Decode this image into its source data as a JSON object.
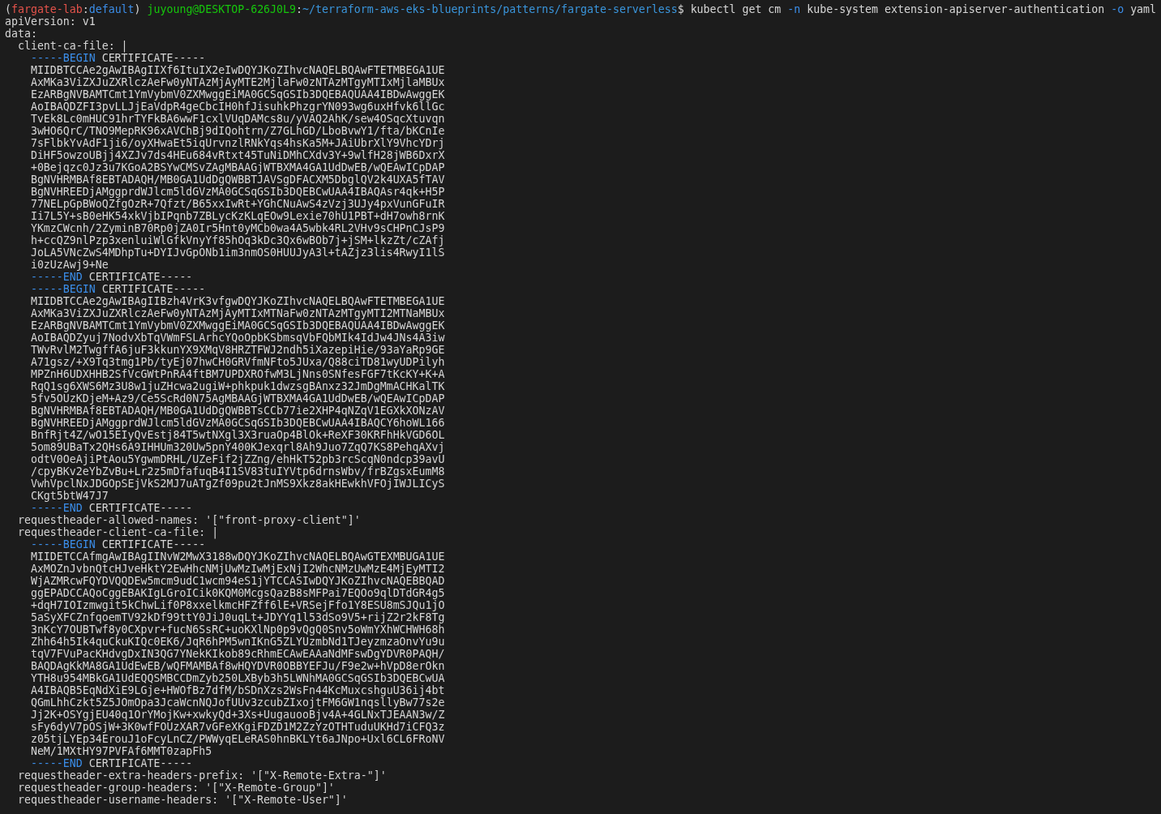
{
  "terminal": {
    "command_line": [
      {
        "text": "(",
        "kind": "plain"
      },
      {
        "text": "fargate-lab",
        "kind": "env"
      },
      {
        "text": ":",
        "kind": "plain"
      },
      {
        "text": "default",
        "kind": "context"
      },
      {
        "text": ") ",
        "kind": "plain"
      },
      {
        "text": "juyoung@DESKTOP-626J0L9",
        "kind": "userhost"
      },
      {
        "text": ":",
        "kind": "plain"
      },
      {
        "text": "~/terraform-aws-eks-blueprints/patterns/fargate-serverless",
        "kind": "path"
      },
      {
        "text": "$ kubectl get cm ",
        "kind": "plain"
      },
      {
        "text": "-n",
        "kind": "flag"
      },
      {
        "text": " kube-system extension-apiserver-authentication ",
        "kind": "plain"
      },
      {
        "text": "-o",
        "kind": "flag"
      },
      {
        "text": " yaml",
        "kind": "plain"
      }
    ],
    "output": [
      {
        "text": "apiVersion: v1"
      },
      {
        "text": "data:",
        "children": [
          {
            "text": "client-ca-file: |",
            "children": [
              {
                "segments": [
                  {
                    "text": "-----BEGIN",
                    "kind": "marker"
                  },
                  {
                    "text": " CERTIFICATE-----",
                    "kind": "plain"
                  }
                ]
              },
              {
                "text": "MIIDBTCCAe2gAwIBAgIIXf6ItuIX2eIwDQYJKoZIhvcNAQELBQAwFTETMBEGA1UE"
              },
              {
                "text": "AxMKa3ViZXJuZXRlczAeFw0yNTAzMjAyMTE2MjlaFw0zNTAzMTgyMTIxMjlaMBUx"
              },
              {
                "text": "EzARBgNVBAMTCmt1YmVybmV0ZXMwggEiMA0GCSqGSIb3DQEBAQUAA4IBDwAwggEK"
              },
              {
                "text": "AoIBAQDZFI3pvLLJjEaVdpR4geCbcIH0hfJisuhkPhzgrYN093wg6uxHfvk6llGc"
              },
              {
                "text": "TvEk8Lc0mHUC91hrTYFkBA6wwF1cxlVUqDAMcs8u/yVAQ2AhK/sew4OSqcXtuvqn"
              },
              {
                "text": "3wHO6QrC/TNO9MepRK96xAVChBj9dIQohtrn/Z7GLhGD/LboBvwY1/fta/bKCnIe"
              },
              {
                "text": "7sFlbkYvAdF1ji6/oyXHwaEt5iqUrvnzlRNkYqs4hsKa5M+JAiUbrXlY9VhcYDrj"
              },
              {
                "text": "DiHF5owzoUBjj4XZJv7ds4HEu684vRtxt45TuNiDMhCXdv3Y+9wlfH28jWB6DxrX"
              },
              {
                "text": "+0Bejqzc0Jz3u7KGoA2BSYwCMSvZAgMBAAGjWTBXMA4GA1UdDwEB/wQEAwICpDAP"
              },
              {
                "text": "BgNVHRMBAf8EBTADAQH/MB0GA1UdDgQWBBTJAVSgDFACXM5DbglQV2k4UXA5fTAV"
              },
              {
                "text": "BgNVHREEDjAMggprdWJlcm5ldGVzMA0GCSqGSIb3DQEBCwUAA4IBAQAsr4qk+H5P"
              },
              {
                "text": "77NELpGpBWoQZfgOzR+7Qfzt/B65xxIwRt+YGhCNuAwS4zVzj3UJy4pxVunGFuIR"
              },
              {
                "text": "Ii7L5Y+sB0eHK54xkVjbIPqnb7ZBLycKzKLqEOw9Lexie70hU1PBT+dH7owh8rnK"
              },
              {
                "text": "YKmzCWcnh/2ZyminB70Rp0jZA0Ir5Hnt0yMCb0wa4A5wbk4RL2VHv9sCHPnCJsP9"
              },
              {
                "text": "h+ccQZ9nlPzp3xenluiWlGfkVnyYf85hOq3kDc3Qx6wBOb7j+jSM+lkzZt/cZAfj"
              },
              {
                "text": "JoLA5VNcZwS4MDhpTu+DYIJvGpONb1im3nmOS0HUUJyA3l+tAZjz3lis4RwyI1lS"
              },
              {
                "text": "i0zUzAwj9+Ne"
              },
              {
                "segments": [
                  {
                    "text": "-----END",
                    "kind": "marker"
                  },
                  {
                    "text": " CERTIFICATE-----",
                    "kind": "plain"
                  }
                ]
              },
              {
                "segments": [
                  {
                    "text": "-----BEGIN",
                    "kind": "marker"
                  },
                  {
                    "text": " CERTIFICATE-----",
                    "kind": "plain"
                  }
                ]
              },
              {
                "text": "MIIDBTCCAe2gAwIBAgIIBzh4VrK3vfgwDQYJKoZIhvcNAQELBQAwFTETMBEGA1UE"
              },
              {
                "text": "AxMKa3ViZXJuZXRlczAeFw0yNTAzMjAyMTIxMTNaFw0zNTAzMTgyMTI2MTNaMBUx"
              },
              {
                "text": "EzARBgNVBAMTCmt1YmVybmV0ZXMwggEiMA0GCSqGSIb3DQEBAQUAA4IBDwAwggEK"
              },
              {
                "text": "AoIBAQDZyuj7NodvXbTqVWmFSLArhcYQoOpbKSbmsqVbFQbMIk4IdJw4JNs4A3iw"
              },
              {
                "text": "TWvRvlM2TwgffA6juF3kkunYX9XMqV8HRZTFWJ2ndh5iXazepiHie/93aYaRp9GE"
              },
              {
                "text": "A71gsz/+X9Tq3tmg1Pb/tyEj07hwCH0GRVfmNFto5JUxa/Q88ciTD81wyUDPilyh"
              },
              {
                "text": "MPZnH6UDXHHB2SfVcGWtPnRA4ftBM7UPDXROfwM3LjNns0SNfesFGF7tKcKY+K+A"
              },
              {
                "text": "RqQ1sg6XWS6Mz3U8w1juZHcwa2ugiW+phkpuk1dwzsgBAnxz32JmDgMmACHKalTK"
              },
              {
                "text": "5fv5OUzKDjeM+Az9/Ce5ScRd0N75AgMBAAGjWTBXMA4GA1UdDwEB/wQEAwICpDAP"
              },
              {
                "text": "BgNVHRMBAf8EBTADAQH/MB0GA1UdDgQWBBTsCCb77ie2XHP4qNZqV1EGXkXONzAV"
              },
              {
                "text": "BgNVHREEDjAMggprdWJlcm5ldGVzMA0GCSqGSIb3DQEBCwUAA4IBAQCY6hoWL166"
              },
              {
                "text": "BnfRjt4Z/wO15EIyQvEstj84T5wtNXgl3X3ruaOp4BlOk+ReXF30KRFhHkVGD6OL"
              },
              {
                "text": "5om89UBaTx2QHs6A9IHHUm320Uw5pnY400KJexqrl8Ah9Juo7ZqQ7KS8PehqAXvj"
              },
              {
                "text": "odtV0OeAjiPtAou5YgwmDRHL/UZeFif2jZZng/ehHkT52pb3rcScqN0ndcp39avU"
              },
              {
                "text": "/cpyBKv2eYbZvBu+Lr2z5mDfafuqB4I1SV83tuIYVtp6drnsWbv/frBZgsxEumM8"
              },
              {
                "text": "VwhVpclNxJDGOpSEjVkS2MJ7uATgZf09pu2tJnMS9Xkz8akHEwkhVFOjIWJLICyS"
              },
              {
                "text": "CKgt5btW47J7"
              },
              {
                "segments": [
                  {
                    "text": "-----END",
                    "kind": "marker"
                  },
                  {
                    "text": " CERTIFICATE-----",
                    "kind": "plain"
                  }
                ]
              }
            ]
          },
          {
            "text": "requestheader-allowed-names: '[\"front-proxy-client\"]'"
          },
          {
            "text": "requestheader-client-ca-file: |",
            "children": [
              {
                "segments": [
                  {
                    "text": "-----BEGIN",
                    "kind": "marker"
                  },
                  {
                    "text": " CERTIFICATE-----",
                    "kind": "plain"
                  }
                ]
              },
              {
                "text": "MIIDETCCAfmgAwIBAgIINvW2MwX3188wDQYJKoZIhvcNAQELBQAwGTEXMBUGA1UE"
              },
              {
                "text": "AxMOZnJvbnQtcHJveHktY2EwHhcNMjUwMzIwMjExNjI2WhcNMzUwMzE4MjEyMTI2"
              },
              {
                "text": "WjAZMRcwFQYDVQQDEw5mcm9udC1wcm94eS1jYTCCASIwDQYJKoZIhvcNAQEBBQAD"
              },
              {
                "text": "ggEPADCCAQoCggEBAKIgLGroICik0KQM0McgsQazB8sMFPai7EQOo9qlDTdGR4g5"
              },
              {
                "text": "+dqH7IOIzmwgit5kChwLif0P8xxelkmcHFZff6lE+VRSejFfo1Y8ESU8mSJQu1jO"
              },
              {
                "text": "5aSyXFCZnfqoemTV92kDf99ttY0JiJ0uqLt+JDYYq1l53dSo9V5+rijZ2r2kF8Tg"
              },
              {
                "text": "3nKcY7OUBTwf8y0CXpvr+fucN6SsRC+uoKXlNp0p9vQgQ0Snv5oWmYXhWCHWH68h"
              },
              {
                "text": "Zhh64h5Ik4quCkuKIQc0EK6/JqR6hPM5wnIKnG5ZLYUzmbNd1TJeyzmzaOnvYu9u"
              },
              {
                "text": "tqV7FVuPacKHdvgDxIN3QG7YNekKIkob89cRhmECAwEAAaNdMFswDgYDVR0PAQH/"
              },
              {
                "text": "BAQDAgKkMA8GA1UdEwEB/wQFMAMBAf8wHQYDVR0OBBYEFJu/F9e2w+hVpD8erOkn"
              },
              {
                "text": "YTH8u954MBkGA1UdEQQSMBCCDmZyb250LXByb3h5LWNhMA0GCSqGSIb3DQEBCwUA"
              },
              {
                "text": "A4IBAQB5EqNdXiE9LGje+HWOfBz7dfM/bSDnXzs2WsFn44KcMuxcshguU36ij4bt"
              },
              {
                "text": "QGmLhhCzkt5Z5JOmOpa3JcaWcnNQJofUUv3zcubZIxojtFM6GW1nqsllyBw77s2e"
              },
              {
                "text": "Jj2K+OSYgjEU40q1OrYMojKw+xwkyQd+3Xs+UugauooBjv4A+4GLNxTJEAAN3w/Z"
              },
              {
                "text": "sFy6dyV7pOSjW+3K0wfFOUzXAR7vGFeXKgiFDZD1M2ZzYzOTHTuduUKHd7iCFQ3z"
              },
              {
                "text": "z05tjLYEp34ErouJ1oFcyLnCZ/PWWyqELeRAS0hnBKLYt6aJNpo+Uxl6CL6FRoNV"
              },
              {
                "text": "NeM/1MXtHY97PVFAf6MMT0zapFh5"
              },
              {
                "segments": [
                  {
                    "text": "-----END",
                    "kind": "marker"
                  },
                  {
                    "text": " CERTIFICATE-----",
                    "kind": "plain"
                  }
                ]
              }
            ]
          },
          {
            "text": "requestheader-extra-headers-prefix: '[\"X-Remote-Extra-\"]'"
          },
          {
            "text": "requestheader-group-headers: '[\"X-Remote-Group\"]'"
          },
          {
            "text": "requestheader-username-headers: '[\"X-Remote-User\"]'"
          }
        ]
      }
    ]
  }
}
